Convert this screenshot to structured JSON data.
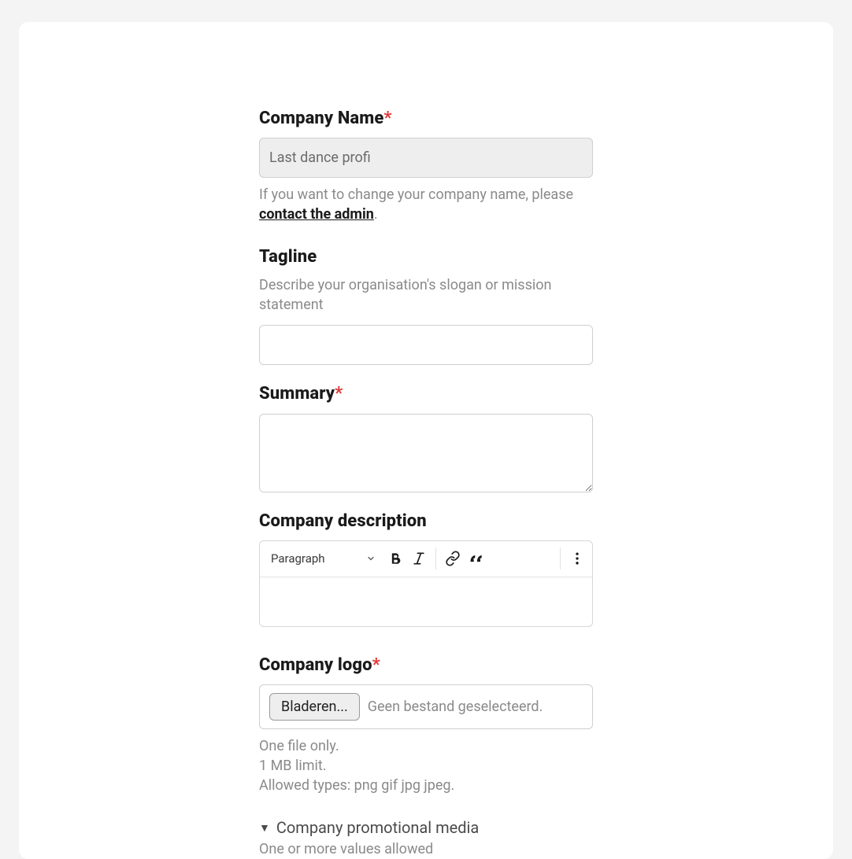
{
  "companyName": {
    "label": "Company Name",
    "required": "*",
    "value": "Last dance profi",
    "help_prefix": "If you want to change your company name, please ",
    "help_link": "contact the admin",
    "help_suffix": "."
  },
  "tagline": {
    "label": "Tagline",
    "description": "Describe your organisation's slogan or mission statement",
    "value": ""
  },
  "summary": {
    "label": "Summary",
    "required": "*",
    "value": ""
  },
  "companyDescription": {
    "label": "Company description",
    "rte": {
      "blockLabel": "Paragraph",
      "icons": {
        "chevron": "chevron-down-icon",
        "bold": "bold-icon",
        "italic": "italic-icon",
        "link": "link-icon",
        "quote": "quote-icon",
        "more": "more-vertical-icon"
      }
    }
  },
  "companyLogo": {
    "label": "Company logo",
    "required": "*",
    "browse": "Bladeren...",
    "noFile": "Geen bestand geselecteerd.",
    "help1": "One file only.",
    "help2": "1 MB limit.",
    "help3": "Allowed types: png gif jpg jpeg."
  },
  "promoMedia": {
    "caret": "▼",
    "title": "Company promotional media",
    "help": "One or more values allowed"
  }
}
